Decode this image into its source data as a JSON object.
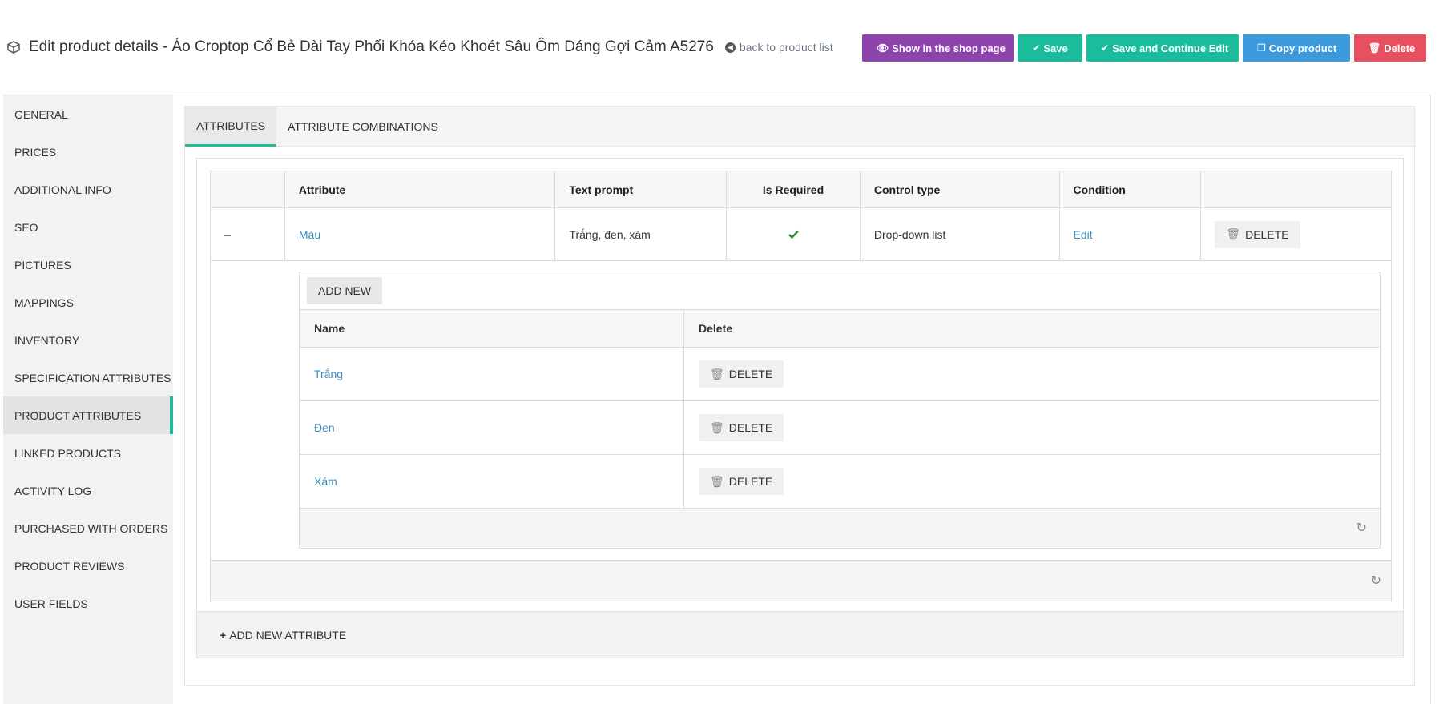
{
  "header": {
    "title": "Edit product details - Áo Croptop Cổ Bẻ Dài Tay Phối Khóa Kéo Khoét Sâu Ôm Dáng Gợi Cảm A5276",
    "back_link": "back to product list",
    "icon": "cube-icon"
  },
  "actions": {
    "show_in_shop": "Show in the shop page",
    "save": "Save",
    "save_continue": "Save and Continue Edit",
    "copy": "Copy product",
    "delete": "Delete"
  },
  "colors": {
    "purple": "#8e44ad",
    "green": "#1abc9c",
    "blue": "#3c99dc",
    "red": "#e65060",
    "link": "#3c8dbc"
  },
  "sidebar": {
    "items": [
      {
        "label": "GENERAL"
      },
      {
        "label": "PRICES"
      },
      {
        "label": "ADDITIONAL INFO"
      },
      {
        "label": "SEO"
      },
      {
        "label": "PICTURES"
      },
      {
        "label": "MAPPINGS"
      },
      {
        "label": "INVENTORY"
      },
      {
        "label": "SPECIFICATION ATTRIBUTES"
      },
      {
        "label": "PRODUCT ATTRIBUTES"
      },
      {
        "label": "LINKED PRODUCTS"
      },
      {
        "label": "ACTIVITY LOG"
      },
      {
        "label": "PURCHASED WITH ORDERS"
      },
      {
        "label": "PRODUCT REVIEWS"
      },
      {
        "label": "USER FIELDS"
      }
    ],
    "active": "PRODUCT ATTRIBUTES"
  },
  "tabs": [
    {
      "label": "ATTRIBUTES"
    },
    {
      "label": "ATTRIBUTE COMBINATIONS"
    }
  ],
  "attributes_table": {
    "columns": [
      "Attribute",
      "Text prompt",
      "Is Required",
      "Control type",
      "Condition"
    ],
    "rows": [
      {
        "toggle": "–",
        "attribute": "Màu",
        "text_prompt": "Trắng, đen, xám",
        "required_icon": "check-icon",
        "control_type": "Drop-down list",
        "condition": "Edit",
        "delete": "DELETE"
      }
    ]
  },
  "values_table": {
    "add_new": "ADD NEW",
    "columns": [
      "Name",
      "Delete"
    ],
    "rows": [
      {
        "name": "Trắng",
        "delete": "DELETE"
      },
      {
        "name": "Đen",
        "delete": "DELETE"
      },
      {
        "name": "Xám",
        "delete": "DELETE"
      }
    ]
  },
  "add_new_attribute": "ADD NEW ATTRIBUTE"
}
